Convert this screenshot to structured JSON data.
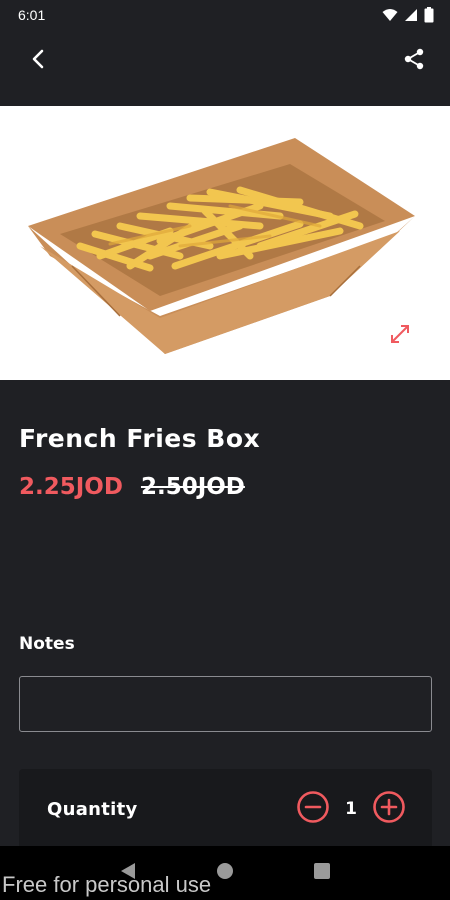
{
  "status_bar": {
    "time": "6:01",
    "icons": [
      "wifi-icon",
      "signal-icon",
      "battery-icon"
    ]
  },
  "app_bar": {
    "back_icon": "chevron-left-icon",
    "share_icon": "share-icon"
  },
  "product": {
    "image_icon": "french-fries-box-image",
    "expand_icon": "expand-icon",
    "title": "French Fries Box",
    "price_current": "2.25JOD",
    "price_old": "2.50JOD"
  },
  "notes": {
    "label": "Notes",
    "value": "",
    "placeholder": ""
  },
  "quantity": {
    "label": "Quantity",
    "value": "1",
    "minus_icon": "minus-circle-icon",
    "plus_icon": "plus-circle-icon"
  },
  "nav_bar": {
    "icons": [
      "back-triangle-icon",
      "home-circle-icon",
      "recents-square-icon"
    ]
  },
  "watermark": "Free for personal use",
  "colors": {
    "background": "#1f2024",
    "accent": "#f05a5f",
    "card": "#18191c"
  }
}
